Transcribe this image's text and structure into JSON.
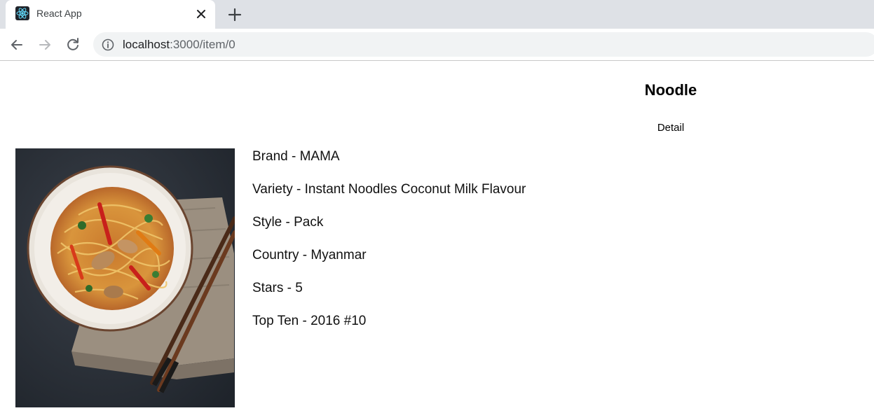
{
  "browser": {
    "tab_title": "React App",
    "url_host": "localhost",
    "url_path": ":3000/item/0"
  },
  "page": {
    "title": "Noodle",
    "subtitle": "Detail",
    "details": [
      "Brand - MAMA",
      "Variety - Instant Noodles Coconut Milk Flavour",
      "Style - Pack",
      "Country - Myanmar",
      "Stars - 5",
      "Top Ten - 2016 #10"
    ]
  },
  "colors": {
    "tabstrip": "#dee1e6",
    "omnibox": "#f1f3f4",
    "react_logo": "#61dafb"
  },
  "icons": [
    "react-logo-icon",
    "close-icon",
    "plus-icon",
    "back-arrow-icon",
    "forward-arrow-icon",
    "reload-icon",
    "info-icon"
  ]
}
